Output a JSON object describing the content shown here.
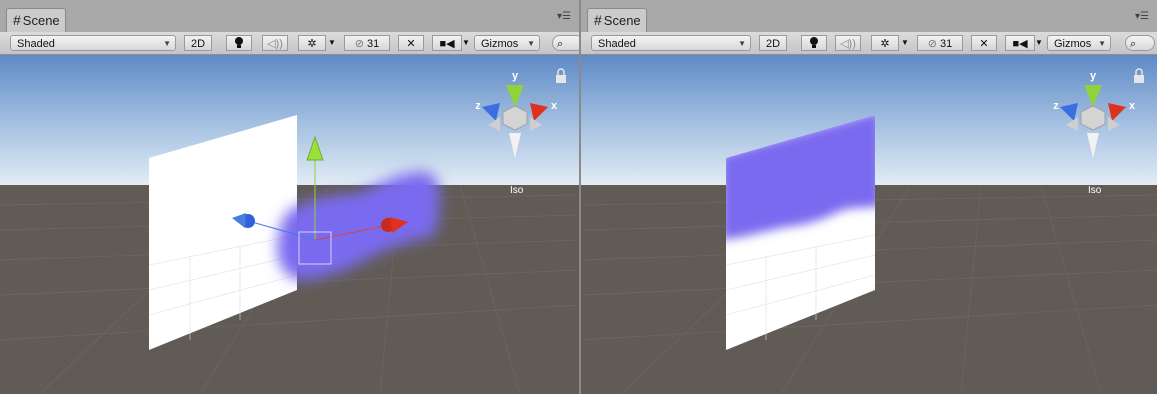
{
  "panels": [
    {
      "tab_title": "Scene",
      "draw_mode": "Shaded",
      "mode_2d": "2D",
      "hidden_count": "31",
      "gizmos_label": "Gizmos",
      "gizmo_axes": {
        "x": "x",
        "y": "y",
        "z": "z"
      },
      "projection_label": "Iso"
    },
    {
      "tab_title": "Scene",
      "draw_mode": "Shaded",
      "mode_2d": "2D",
      "hidden_count": "31",
      "gizmos_label": "Gizmos",
      "gizmo_axes": {
        "x": "x",
        "y": "y",
        "z": "z"
      },
      "projection_label": "Iso"
    }
  ],
  "icons": [
    "hash-icon",
    "tab-menu-icon",
    "lighting-icon",
    "audio-icon",
    "effects-icon",
    "hidden-objects-icon",
    "tools-icon",
    "camera-icon",
    "search-icon",
    "lock-icon"
  ],
  "colors": {
    "sky_top": "#5b87c2",
    "sky_horizon": "#dce8f2",
    "ground": "#605a55",
    "decal_purple": "#7b6cf0",
    "plane_white": "#ffffff",
    "axis_x": "#e0301e",
    "axis_y": "#86d02d",
    "axis_z": "#3b6fe0"
  }
}
